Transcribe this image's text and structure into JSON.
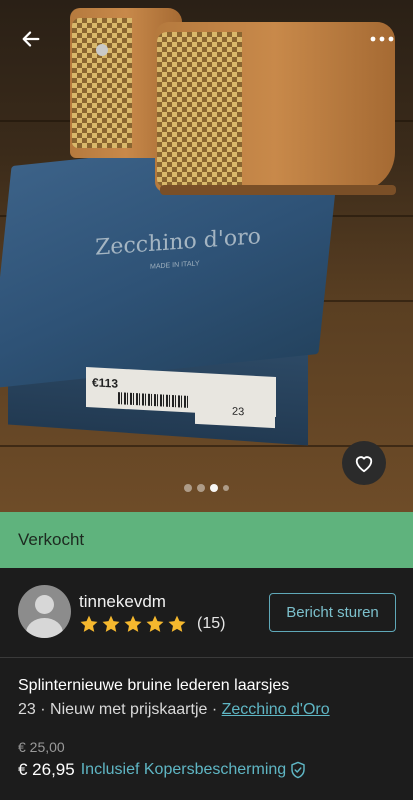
{
  "photo": {
    "box_brand": "Zecchino d'oro",
    "box_sub": "MADE IN ITALY",
    "price_tag": "€113",
    "size_on_box": "23",
    "carousel": {
      "count": 4,
      "active_index": 2
    }
  },
  "status": {
    "label": "Verkocht",
    "color": "#5fb37d"
  },
  "seller": {
    "username": "tinnekevdm",
    "rating_stars": 5,
    "review_count": "(15)",
    "message_button": "Bericht sturen"
  },
  "item": {
    "title": "Splinternieuwe bruine lederen laarsjes",
    "size": "23",
    "separator": " · ",
    "condition": "Nieuw met prijskaartje",
    "brand": "Zecchino d'Oro",
    "price": "€ 25,00",
    "total_price": "€ 26,95",
    "protection_label": "Inclusief Kopersbescherming"
  },
  "colors": {
    "accent": "#5fb6c4",
    "star": "#f5b82e",
    "background": "#1c1c1c"
  },
  "icons": {
    "back": "back-arrow-icon",
    "more": "more-dots-icon",
    "favorite": "heart-icon",
    "protection": "shield-check-icon"
  }
}
